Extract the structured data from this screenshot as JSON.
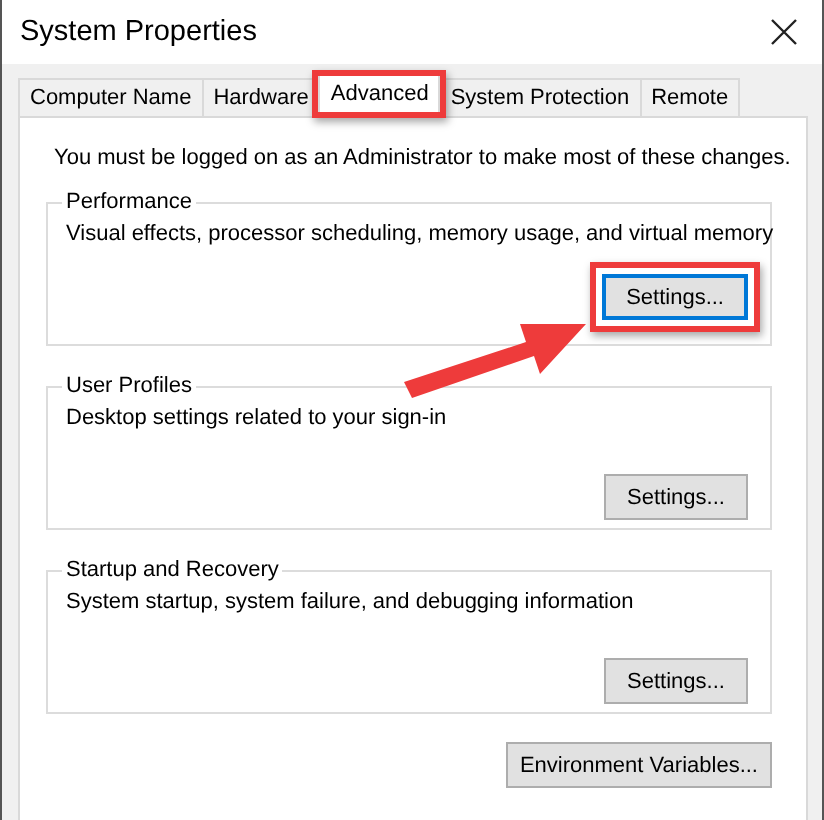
{
  "window": {
    "title": "System Properties"
  },
  "tabs": [
    {
      "label": "Computer Name",
      "selected": false,
      "highlighted": false
    },
    {
      "label": "Hardware",
      "selected": false,
      "highlighted": false
    },
    {
      "label": "Advanced",
      "selected": true,
      "highlighted": true
    },
    {
      "label": "System Protection",
      "selected": false,
      "highlighted": false
    },
    {
      "label": "Remote",
      "selected": false,
      "highlighted": false
    }
  ],
  "notice": "You must be logged on as an Administrator to make most of these changes.",
  "groups": [
    {
      "title": "Performance",
      "description": "Visual effects, processor scheduling, memory usage, and virtual memory",
      "button": {
        "label": "Settings...",
        "focused": true,
        "highlighted": true
      }
    },
    {
      "title": "User Profiles",
      "description": "Desktop settings related to your sign-in",
      "button": {
        "label": "Settings...",
        "focused": false,
        "highlighted": false
      }
    },
    {
      "title": "Startup and Recovery",
      "description": "System startup, system failure, and debugging information",
      "button": {
        "label": "Settings...",
        "focused": false,
        "highlighted": false
      }
    }
  ],
  "environment_button": {
    "label": "Environment Variables..."
  },
  "callout_arrow": true
}
